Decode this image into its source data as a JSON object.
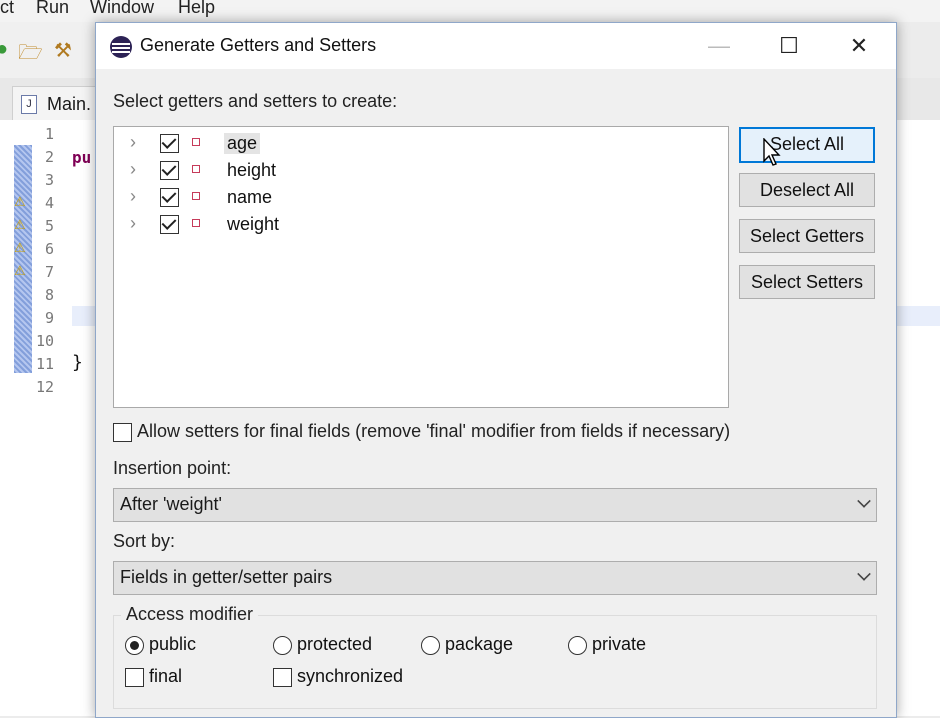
{
  "ide": {
    "menu": [
      "ct",
      "Run",
      "Window",
      "Help"
    ],
    "editor_tab": "Main.",
    "line_numbers": [
      "1",
      "2",
      "3",
      "4",
      "5",
      "6",
      "7",
      "8",
      "9",
      "10",
      "11",
      "12"
    ],
    "code_line2": "pu",
    "code_line11": "}"
  },
  "dialog": {
    "title": "Generate Getters and Setters",
    "window_buttons": {
      "minimize": "—",
      "maximize": "☐",
      "close": "✕"
    },
    "prompt": "Select getters and setters to create:",
    "fields": [
      {
        "name": "age",
        "checked": true,
        "selected": true
      },
      {
        "name": "height",
        "checked": true,
        "selected": false
      },
      {
        "name": "name",
        "checked": true,
        "selected": false
      },
      {
        "name": "weight",
        "checked": true,
        "selected": false
      }
    ],
    "buttons": {
      "select_all": "Select All",
      "deselect_all": "Deselect All",
      "select_getters": "Select Getters",
      "select_setters": "Select Setters"
    },
    "allow_final_label": "Allow setters for final fields (remove 'final' modifier from fields if necessary)",
    "allow_final_checked": false,
    "insertion_label": "Insertion point:",
    "insertion_value": "After 'weight'",
    "sort_label": "Sort by:",
    "sort_value": "Fields in getter/setter pairs",
    "access_title": "Access modifier",
    "access_options": [
      "public",
      "protected",
      "package",
      "private"
    ],
    "access_selected": "public",
    "modifier_final": "final",
    "modifier_synchronized": "synchronized"
  },
  "colors": {
    "focus_border": "#0078d7",
    "field_icon": "#c63b5a"
  }
}
